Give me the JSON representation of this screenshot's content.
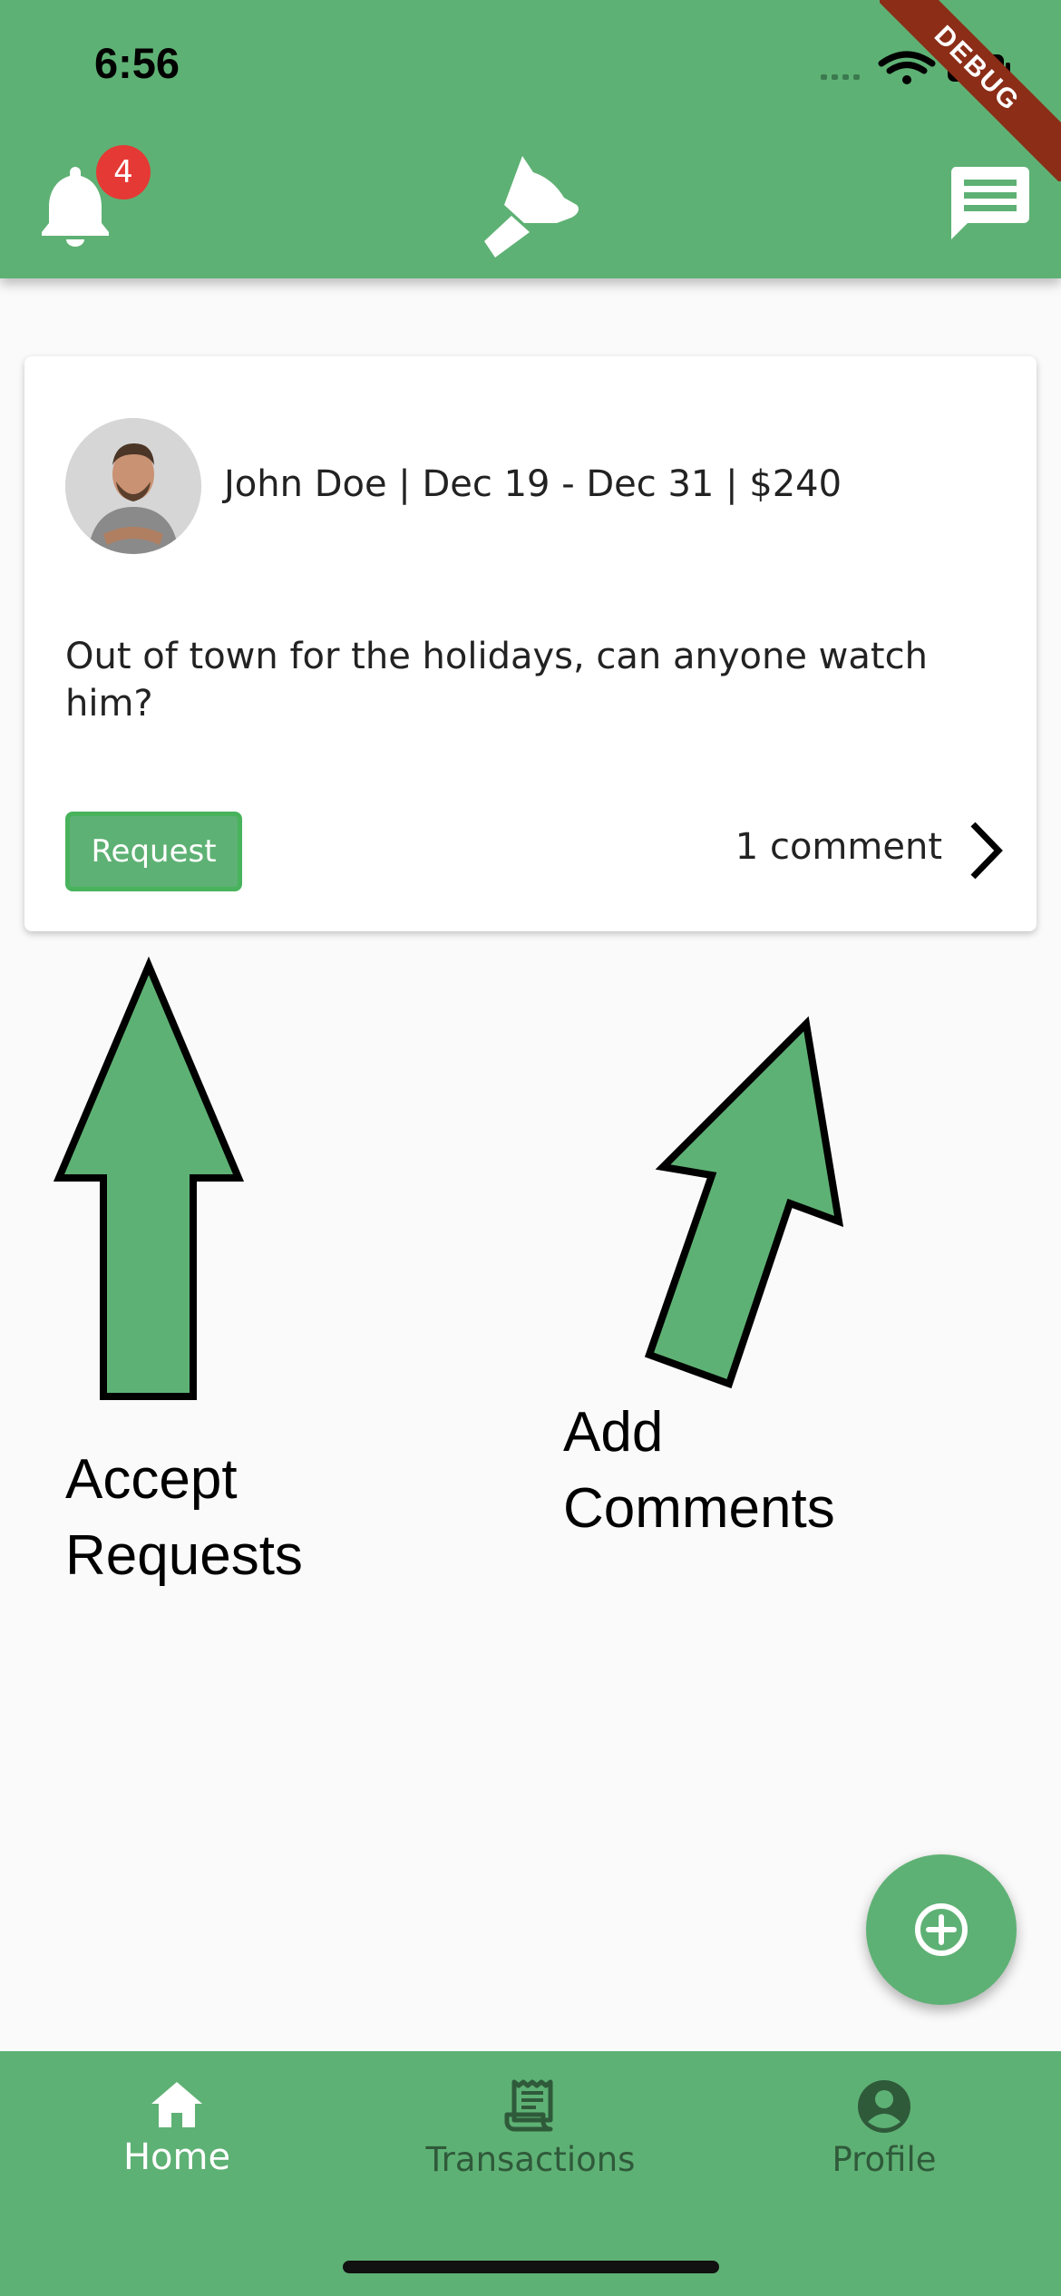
{
  "status_bar": {
    "time": "6:56"
  },
  "debug_banner": "DEBUG",
  "app_bar": {
    "notification_count": "4",
    "left_icon": "bell-icon",
    "center_icon": "dog-head-logo",
    "right_icon": "chat-icon"
  },
  "post": {
    "author": "John Doe",
    "dates": "Dec 19 - Dec 31",
    "price": "$240",
    "meta_line": "John Doe | Dec 19 - Dec 31 | $240",
    "body": "Out of town for the holidays, can anyone watch him?",
    "request_label": "Request",
    "comments_label": "1 comment"
  },
  "annotations": {
    "left_line1": "Accept",
    "left_line2": "Requests",
    "right_line1": "Add",
    "right_line2": "Comments"
  },
  "fab_icon": "plus-circle-icon",
  "bottom_nav": {
    "items": [
      {
        "label": "Home",
        "icon": "home-icon",
        "active": true
      },
      {
        "label": "Transactions",
        "icon": "receipt-icon",
        "active": false
      },
      {
        "label": "Profile",
        "icon": "account-circle-icon",
        "active": false
      }
    ]
  },
  "colors": {
    "primary": "#5eb174",
    "badge": "#e53935",
    "debug": "#8b2d17"
  }
}
